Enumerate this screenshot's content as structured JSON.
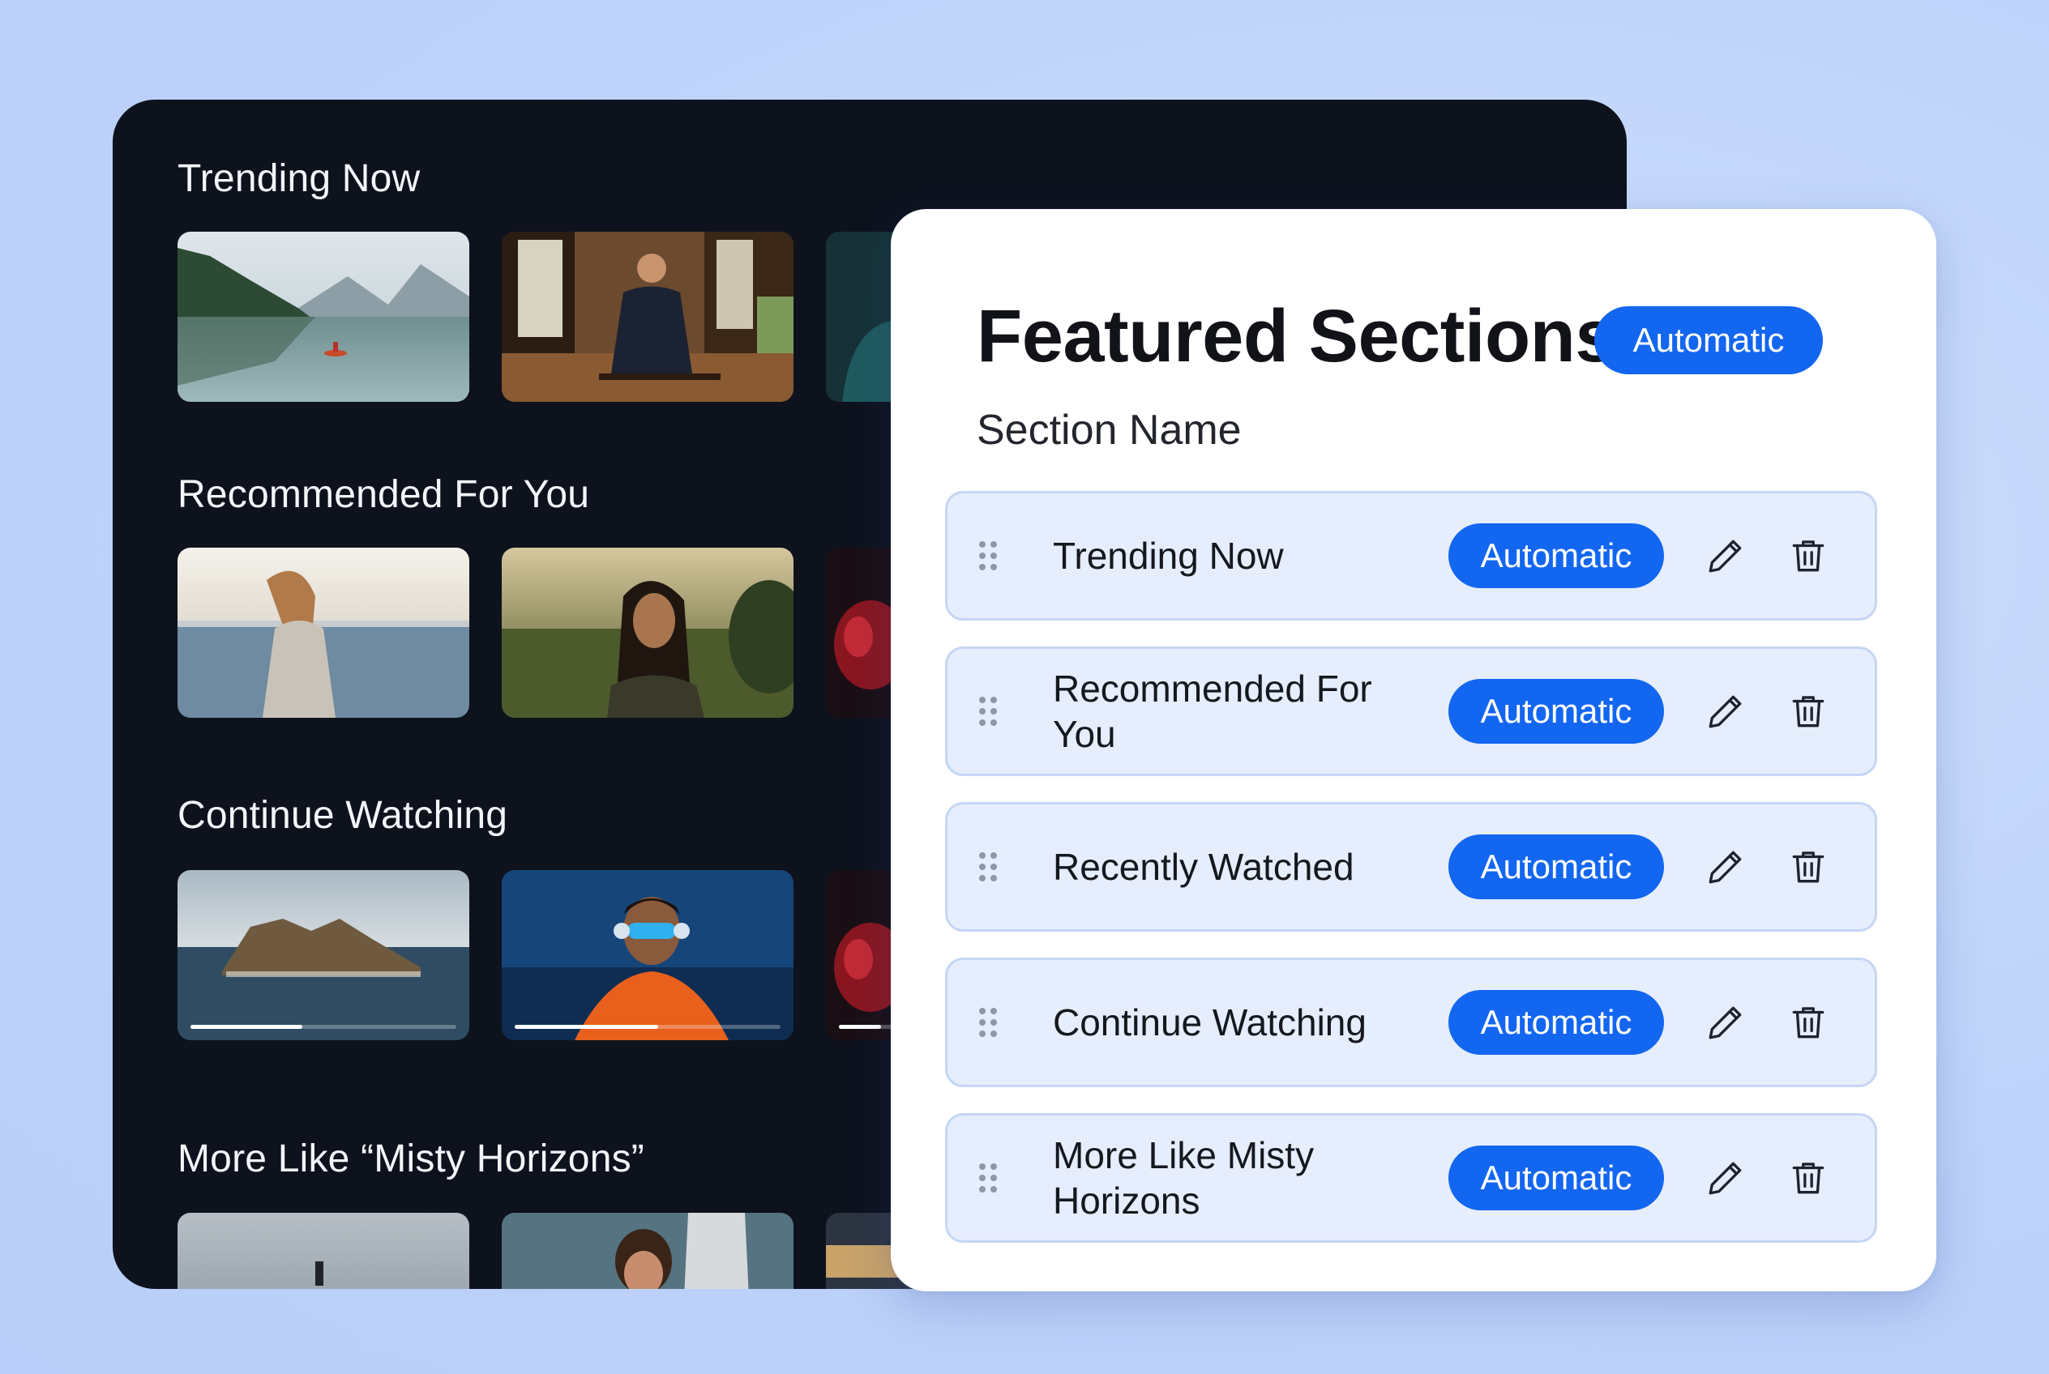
{
  "preview": {
    "rows": [
      {
        "title": "Trending Now",
        "thumbs": [
          "lake-kayak",
          "martial-artist",
          "partial-teal"
        ]
      },
      {
        "title": "Recommended For You",
        "thumbs": [
          "woman-sea",
          "woman-field",
          "partial-red"
        ]
      },
      {
        "title": "Continue Watching",
        "thumbs": [
          "island",
          "headphones-man",
          "partial-red"
        ],
        "progress": [
          0.42,
          0.54,
          0.5
        ]
      },
      {
        "title": "More Like “Misty Horizons”",
        "thumbs": [
          "misty-lake",
          "woman-curtain",
          "partial-sunset"
        ]
      }
    ]
  },
  "panel": {
    "title": "Featured Sections",
    "badge": "Automatic",
    "column_label": "Section Name",
    "sections": [
      {
        "name": "Trending Now",
        "mode": "Automatic"
      },
      {
        "name": "Recommended For You",
        "mode": "Automatic"
      },
      {
        "name": "Recently Watched",
        "mode": "Automatic"
      },
      {
        "name": "Continue Watching",
        "mode": "Automatic"
      },
      {
        "name": "More Like Misty Horizons",
        "mode": "Automatic"
      }
    ],
    "icons": {
      "drag": "drag-handle-icon",
      "edit": "pencil-icon",
      "delete": "trash-icon"
    }
  },
  "colors": {
    "accent": "#1366f0",
    "row_bg": "#e6edfd",
    "dark_panel": "#0d121d",
    "page_bg": "#c4d7fb"
  }
}
